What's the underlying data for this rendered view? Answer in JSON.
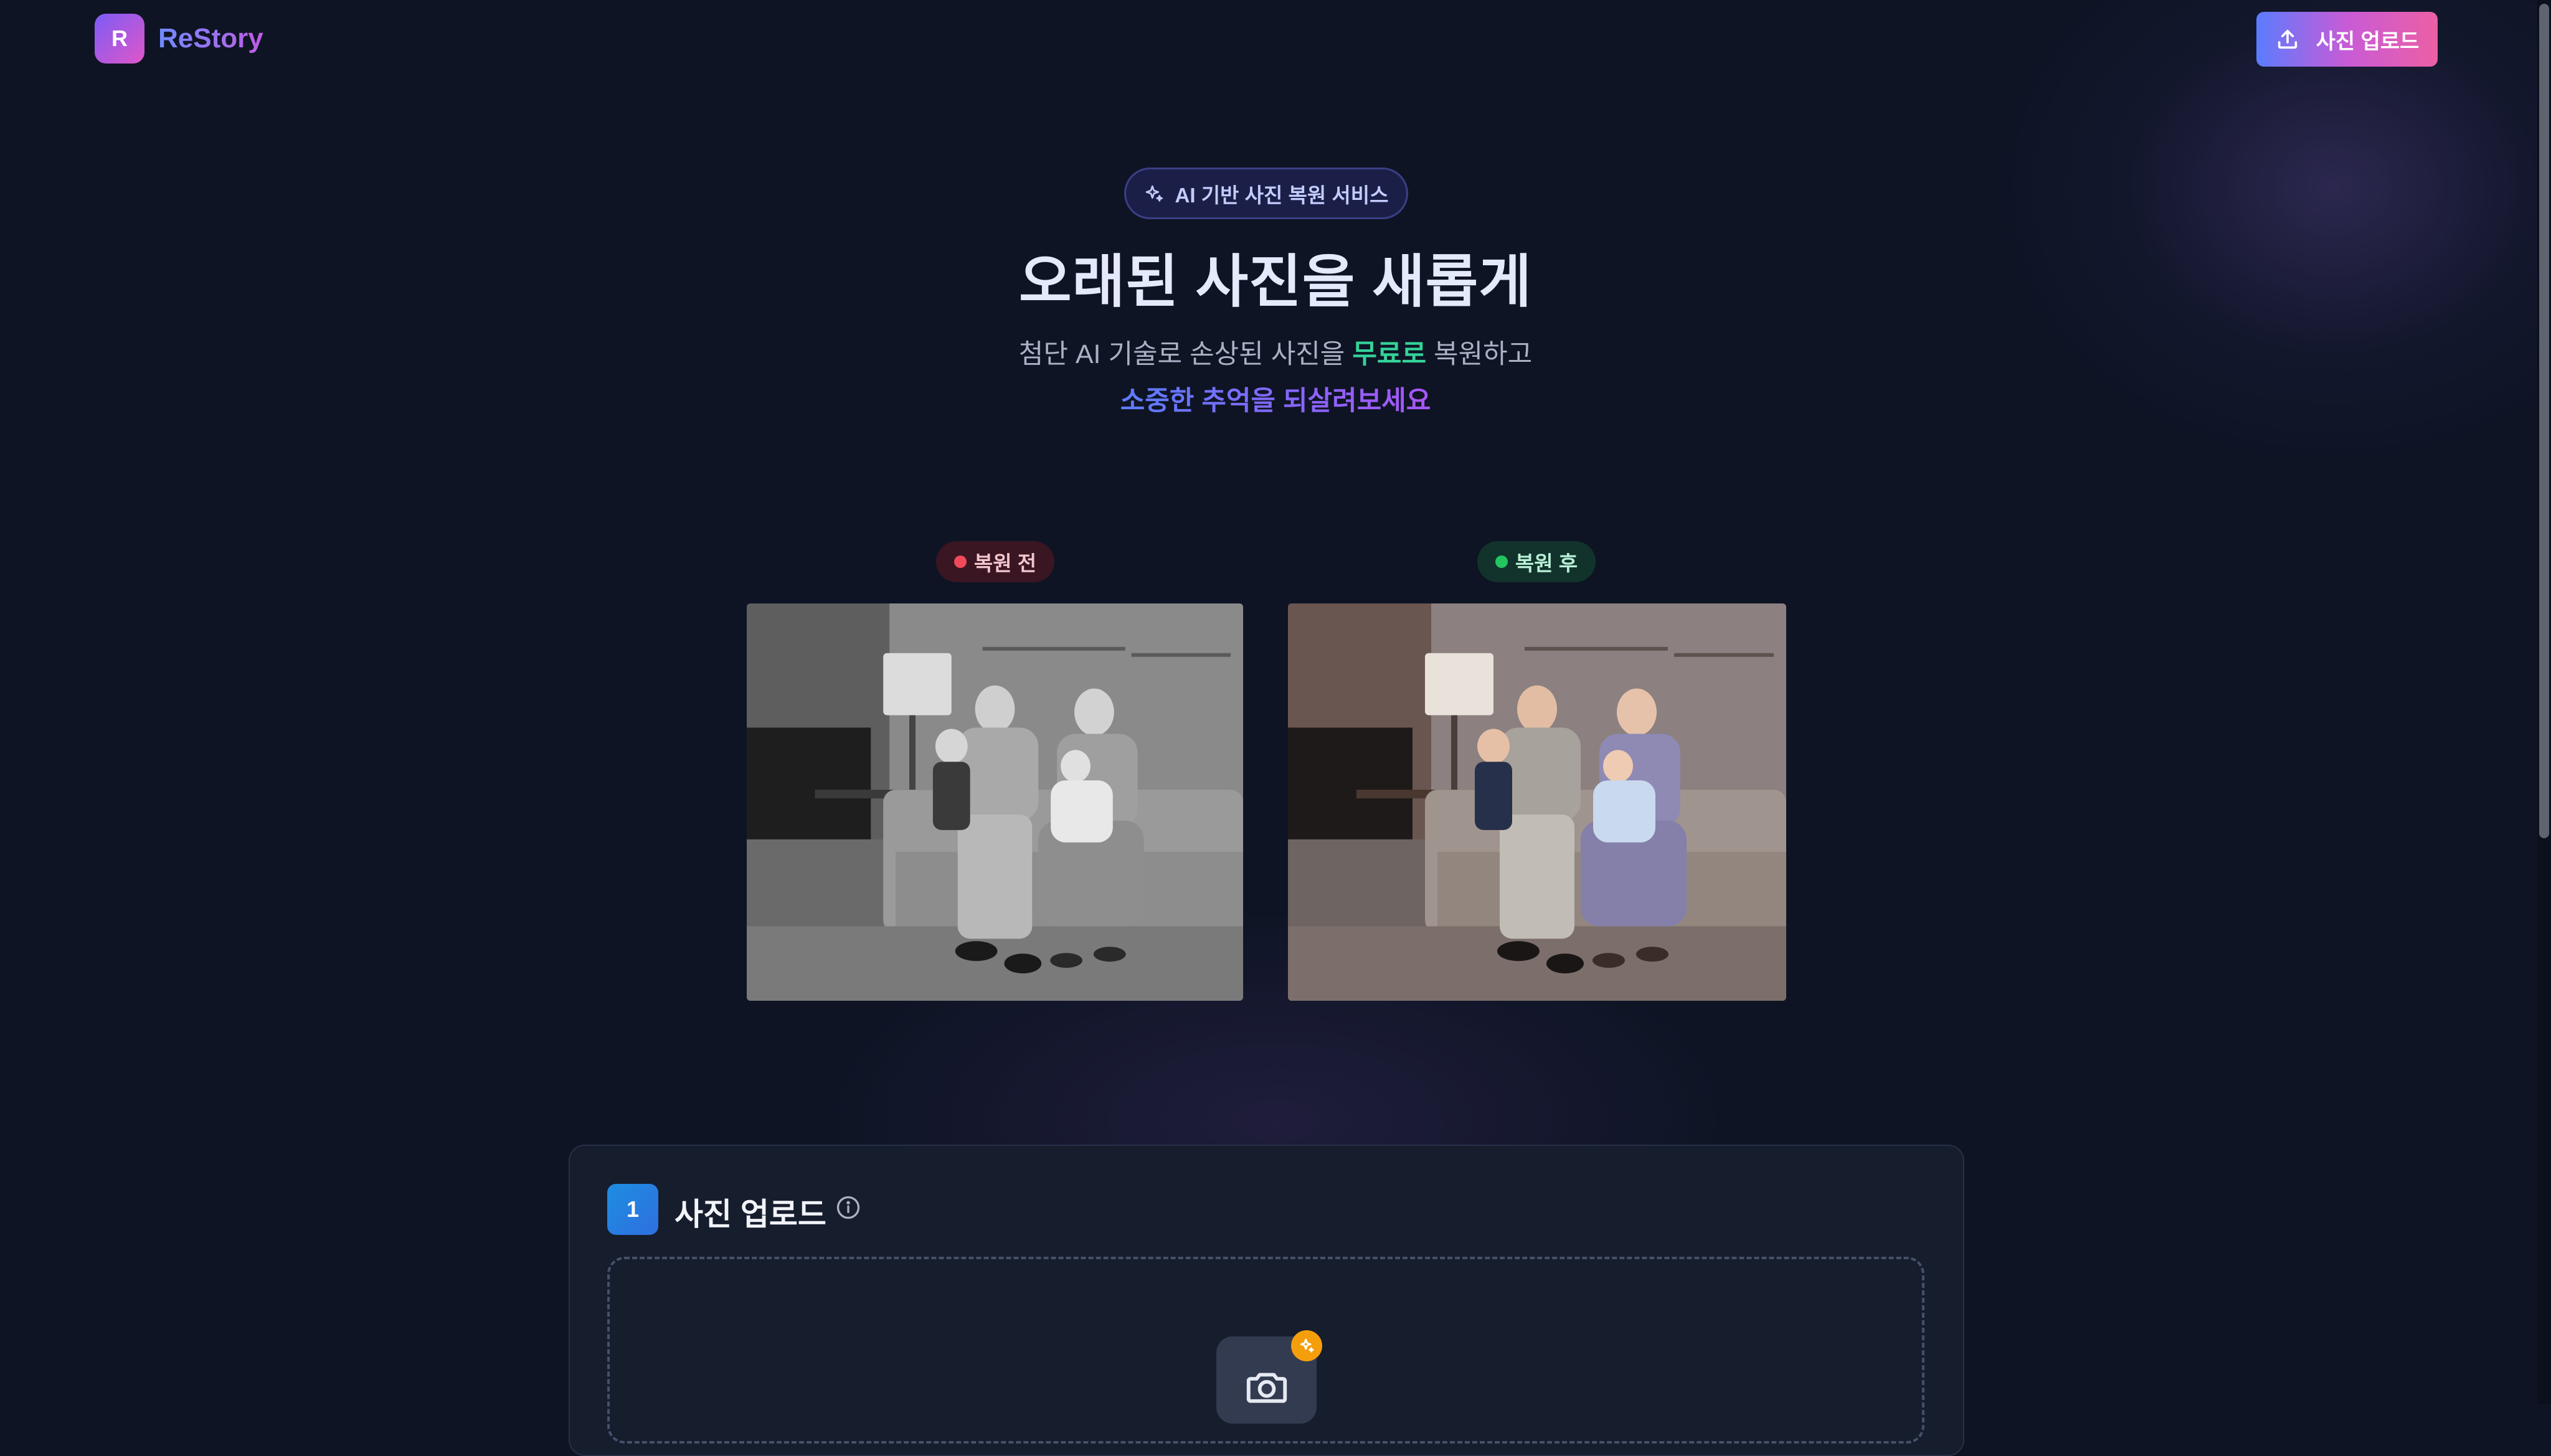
{
  "header": {
    "logo_letter": "R",
    "brand_name": "ReStory",
    "upload_button": "사진 업로드"
  },
  "hero": {
    "badge": "AI 기반 사진 복원 서비스",
    "title": "오래된 사진을 새롭게",
    "subtitle_line1_part1": "첨단 AI 기술로 손상된 사진을 ",
    "subtitle_line1_highlight": "무료로",
    "subtitle_line1_part2": " 복원하고",
    "subtitle_line2": "소중한 추억을 되살려보세요"
  },
  "compare": {
    "before_label": "복원 전",
    "after_label": "복원 후"
  },
  "upload_section": {
    "step_number": "1",
    "title": "사진 업로드"
  },
  "colors": {
    "background": "#0e1424",
    "brand_gradient_start": "#5b7cff",
    "brand_gradient_end": "#ec5fa5",
    "free_highlight": "#34d399",
    "before_dot": "#f04a5a",
    "after_dot": "#22c55e",
    "step_badge": "#1d8ee0",
    "sparkle_badge": "#f59e0b"
  },
  "icons": {
    "upload": "upload-icon",
    "sparkle": "sparkle-icon",
    "info": "info-icon",
    "camera": "camera-icon"
  }
}
